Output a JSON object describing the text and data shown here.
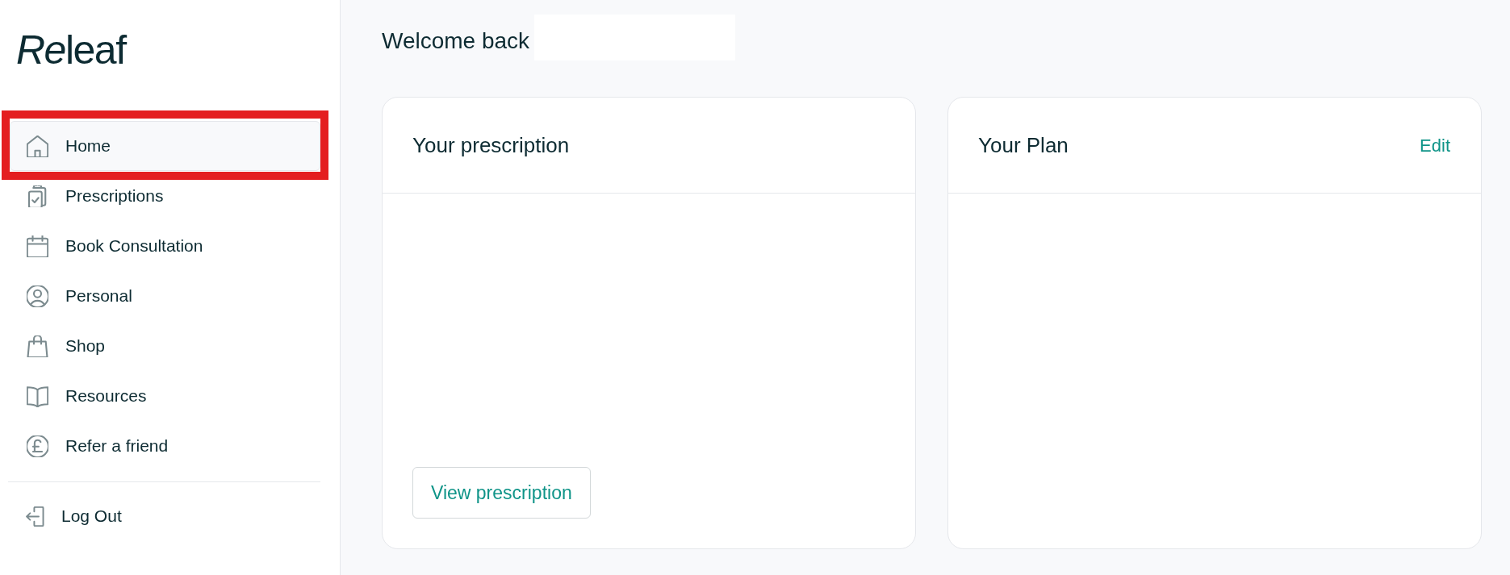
{
  "logo": {
    "text": "Releaf"
  },
  "sidebar": {
    "items": [
      {
        "label": "Home",
        "selected": true,
        "highlighted": true
      },
      {
        "label": "Prescriptions",
        "selected": false,
        "highlighted": false
      },
      {
        "label": "Book Consultation",
        "selected": false,
        "highlighted": false
      },
      {
        "label": "Personal",
        "selected": false,
        "highlighted": false
      },
      {
        "label": "Shop",
        "selected": false,
        "highlighted": false
      },
      {
        "label": "Resources",
        "selected": false,
        "highlighted": false
      },
      {
        "label": "Refer a friend",
        "selected": false,
        "highlighted": false
      }
    ],
    "footer_item": {
      "label": "Log Out"
    }
  },
  "header": {
    "greeting": "Welcome back"
  },
  "cards": [
    {
      "title": "Your prescription",
      "button": "View prescription"
    },
    {
      "title": "Your Plan",
      "action": "Edit"
    }
  ]
}
